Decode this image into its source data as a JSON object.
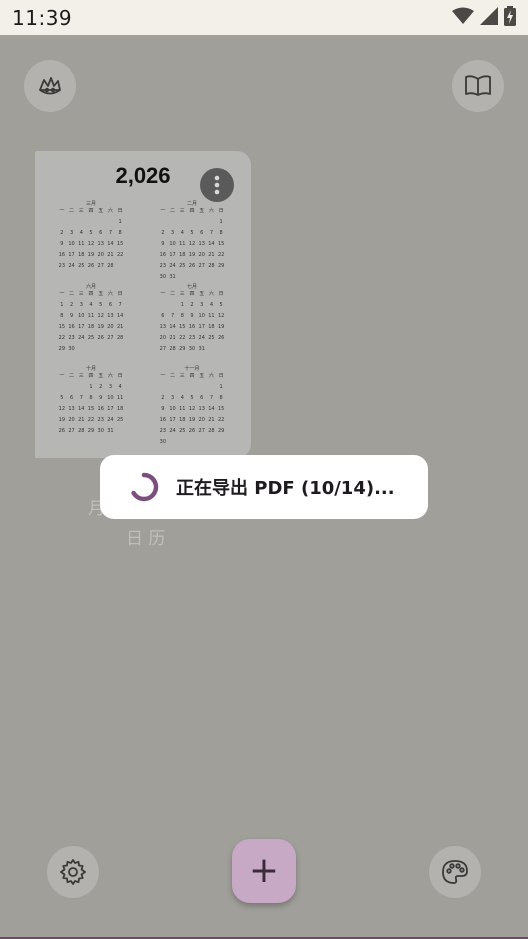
{
  "status_bar": {
    "time": "11:39",
    "icons": [
      "wifi-icon",
      "signal-icon",
      "battery-charging-icon"
    ]
  },
  "toolbar": {
    "left_icon": "crown-hand-icon",
    "right_icon": "book-open-icon"
  },
  "calendar_card": {
    "year_title": "2,026",
    "months": [
      {
        "name": "三月",
        "headers": [
          "一",
          "二",
          "三",
          "四",
          "五",
          "六",
          "日"
        ],
        "rows": [
          [
            "",
            "",
            "",
            "",
            "",
            "",
            "1"
          ],
          [
            "2",
            "3",
            "4",
            "5",
            "6",
            "7",
            "8"
          ],
          [
            "9",
            "10",
            "11",
            "12",
            "13",
            "14",
            "15"
          ],
          [
            "16",
            "17",
            "18",
            "19",
            "20",
            "21",
            "22"
          ],
          [
            "23",
            "24",
            "25",
            "26",
            "27",
            "28",
            ""
          ]
        ]
      },
      {
        "name": "二月",
        "headers": [
          "一",
          "二",
          "三",
          "四",
          "五",
          "六",
          "日"
        ],
        "rows": [
          [
            "",
            "",
            "",
            "",
            "",
            "",
            "1"
          ],
          [
            "2",
            "3",
            "4",
            "5",
            "6",
            "7",
            "8"
          ],
          [
            "9",
            "10",
            "11",
            "12",
            "13",
            "14",
            "15"
          ],
          [
            "16",
            "17",
            "18",
            "19",
            "20",
            "21",
            "22"
          ],
          [
            "23",
            "24",
            "25",
            "26",
            "27",
            "28",
            "29"
          ],
          [
            "30",
            "31",
            "",
            "",
            "",
            "",
            ""
          ]
        ]
      },
      {
        "name": "六月",
        "headers": [
          "一",
          "二",
          "三",
          "四",
          "五",
          "六",
          "日"
        ],
        "rows": [
          [
            "1",
            "2",
            "3",
            "4",
            "5",
            "6",
            "7"
          ],
          [
            "8",
            "9",
            "10",
            "11",
            "12",
            "13",
            "14"
          ],
          [
            "15",
            "16",
            "17",
            "18",
            "19",
            "20",
            "21"
          ],
          [
            "22",
            "23",
            "24",
            "25",
            "26",
            "27",
            "28"
          ],
          [
            "29",
            "30",
            "",
            "",
            "",
            "",
            ""
          ]
        ]
      },
      {
        "name": "七月",
        "headers": [
          "一",
          "二",
          "三",
          "四",
          "五",
          "六",
          "日"
        ],
        "rows": [
          [
            "",
            "",
            "1",
            "2",
            "3",
            "4",
            "5"
          ],
          [
            "6",
            "7",
            "8",
            "9",
            "10",
            "11",
            "12"
          ],
          [
            "13",
            "14",
            "15",
            "16",
            "17",
            "18",
            "19"
          ],
          [
            "20",
            "21",
            "22",
            "23",
            "24",
            "25",
            "26"
          ],
          [
            "27",
            "28",
            "29",
            "30",
            "31",
            "",
            ""
          ]
        ]
      },
      {
        "name": "十月",
        "headers": [
          "一",
          "二",
          "三",
          "四",
          "五",
          "六",
          "日"
        ],
        "rows": [
          [
            "",
            "",
            "",
            "1",
            "2",
            "3",
            "4"
          ],
          [
            "5",
            "6",
            "7",
            "8",
            "9",
            "10",
            "11"
          ],
          [
            "12",
            "13",
            "14",
            "15",
            "16",
            "17",
            "18"
          ],
          [
            "19",
            "20",
            "21",
            "22",
            "23",
            "24",
            "25"
          ],
          [
            "26",
            "27",
            "28",
            "29",
            "30",
            "31",
            ""
          ]
        ]
      },
      {
        "name": "十一月",
        "headers": [
          "一",
          "二",
          "三",
          "四",
          "五",
          "六",
          "日"
        ],
        "rows": [
          [
            "",
            "",
            "",
            "",
            "",
            "",
            "1"
          ],
          [
            "2",
            "3",
            "4",
            "5",
            "6",
            "7",
            "8"
          ],
          [
            "9",
            "10",
            "11",
            "12",
            "13",
            "14",
            "15"
          ],
          [
            "16",
            "17",
            "18",
            "19",
            "20",
            "21",
            "22"
          ],
          [
            "23",
            "24",
            "25",
            "26",
            "27",
            "28",
            "29"
          ],
          [
            "30",
            "",
            "",
            "",
            "",
            "",
            ""
          ]
        ]
      }
    ]
  },
  "card_labels": {
    "line1": "月",
    "line2": "日 历"
  },
  "export_dialog": {
    "message": "正在导出 PDF (10/14)..."
  },
  "bottom_bar": {
    "settings_icon": "gear-icon",
    "fab_label": "+",
    "palette_icon": "palette-icon"
  },
  "colors": {
    "scrim": "#a09f9a",
    "accent": "#7b4f7d",
    "fab": "#c7a9c6"
  }
}
